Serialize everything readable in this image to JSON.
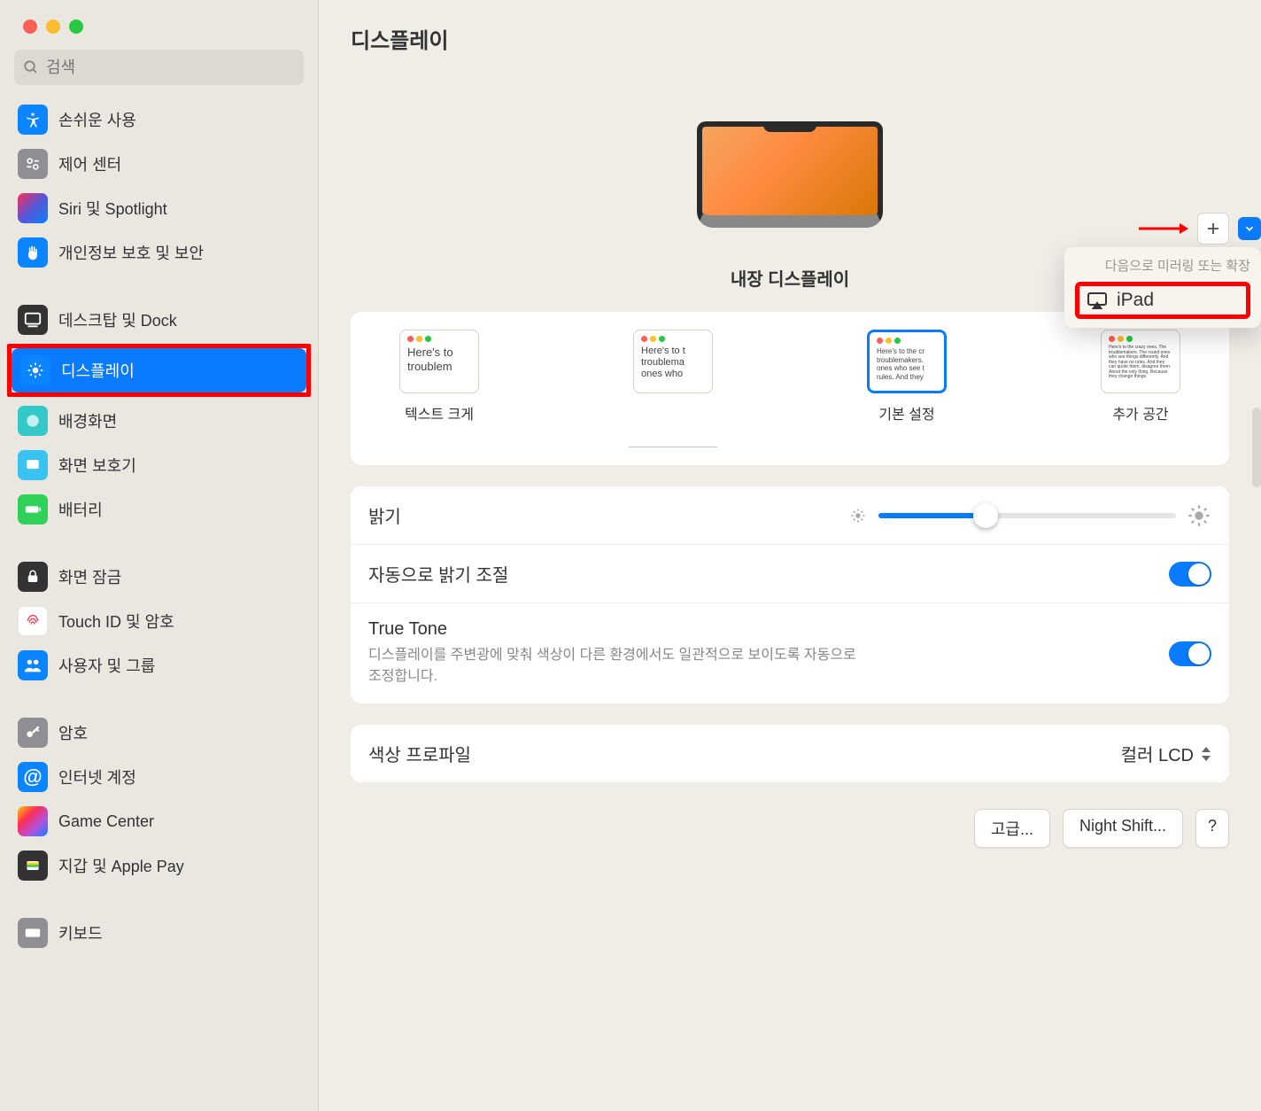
{
  "search": {
    "placeholder": "검색"
  },
  "sidebar": {
    "items": [
      {
        "label": "손쉬운 사용",
        "icon": "ic-access"
      },
      {
        "label": "제어 센터",
        "icon": "ic-control"
      },
      {
        "label": "Siri 및 Spotlight",
        "icon": "ic-siri"
      },
      {
        "label": "개인정보 보호 및 보안",
        "icon": "ic-privacy"
      },
      {
        "label": "데스크탑 및 Dock",
        "icon": "ic-desktop"
      },
      {
        "label": "디스플레이",
        "icon": "ic-display",
        "selected": true
      },
      {
        "label": "배경화면",
        "icon": "ic-wall"
      },
      {
        "label": "화면 보호기",
        "icon": "ic-saver"
      },
      {
        "label": "배터리",
        "icon": "ic-battery"
      },
      {
        "label": "화면 잠금",
        "icon": "ic-lock"
      },
      {
        "label": "Touch ID 및 암호",
        "icon": "ic-touch"
      },
      {
        "label": "사용자 및 그룹",
        "icon": "ic-users"
      },
      {
        "label": "암호",
        "icon": "ic-pass"
      },
      {
        "label": "인터넷 계정",
        "icon": "ic-internet"
      },
      {
        "label": "Game Center",
        "icon": "ic-game"
      },
      {
        "label": "지갑 및 Apple Pay",
        "icon": "ic-wallet"
      },
      {
        "label": "키보드",
        "icon": "ic-keyboard"
      }
    ]
  },
  "header": {
    "title": "디스플레이"
  },
  "monitor": {
    "caption": "내장 디스플레이"
  },
  "popover": {
    "title": "다음으로 미러링 또는 확장",
    "item": "iPad"
  },
  "resolution": {
    "options": [
      {
        "label": "텍스트 크게",
        "sample_size": "large"
      },
      {
        "label": "",
        "sample_size": "medium-empty"
      },
      {
        "label": "기본 설정",
        "sample_size": "medium",
        "selected": true
      },
      {
        "label": "추가 공간",
        "sample_size": "tiny"
      }
    ],
    "sample_text": "Here's to the crazy ones. The troublemakers. The round ones who see things differently. And they have no rules. And they can quote them, disagree them. About the only thing. Because they change things."
  },
  "settings": {
    "brightness": {
      "label": "밝기",
      "value_pct": 36
    },
    "auto_brightness": {
      "label": "자동으로 밝기 조절",
      "on": true
    },
    "true_tone": {
      "label": "True Tone",
      "desc": "디스플레이를 주변광에 맞춰 색상이 다른 환경에서도 일관적으로 보이도록 자동으로 조정합니다.",
      "on": true
    },
    "color_profile": {
      "label": "색상 프로파일",
      "value": "컬러 LCD"
    }
  },
  "buttons": {
    "advanced": "고급...",
    "night_shift": "Night Shift...",
    "help": "?"
  },
  "colors": {
    "accent": "#0a7aff",
    "annotation": "#ff0000"
  }
}
